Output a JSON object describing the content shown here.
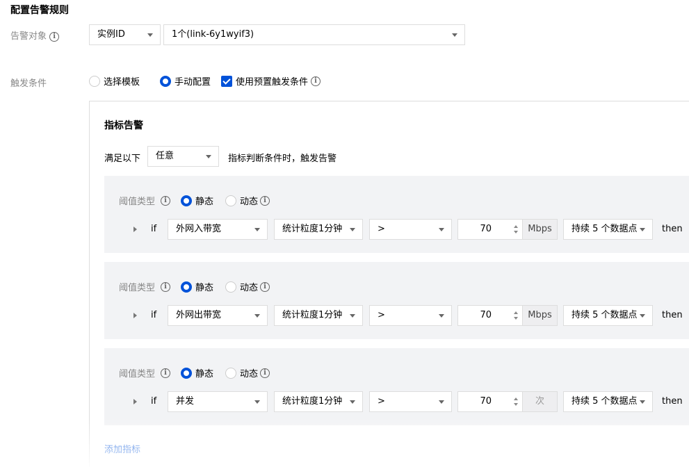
{
  "page_title": "配置告警规则",
  "alarm_target": {
    "label": "告警对象",
    "type_select": "实例ID",
    "instance_select": "1个(link-6y1wyif3)"
  },
  "trigger": {
    "label": "触发条件",
    "option_template": "选择模板",
    "option_manual": "手动配置",
    "checkbox_preset": "使用预置触发条件"
  },
  "metric_alarm": {
    "title": "指标告警",
    "satisfy_prefix": "满足以下",
    "satisfy_select": "任意",
    "satisfy_suffix": "指标判断条件时，触发告警",
    "add_metric": "添加指标",
    "rules": [
      {
        "threshold_label": "阈值类型",
        "static_label": "静态",
        "dynamic_label": "动态",
        "if_label": "if",
        "metric": "外网入带宽",
        "period": "统计粒度1分钟",
        "operator": ">",
        "value": "70",
        "unit": "Mbps",
        "duration": "持续 5 个数据点",
        "then_label": "then"
      },
      {
        "threshold_label": "阈值类型",
        "static_label": "静态",
        "dynamic_label": "动态",
        "if_label": "if",
        "metric": "外网出带宽",
        "period": "统计粒度1分钟",
        "operator": ">",
        "value": "70",
        "unit": "Mbps",
        "duration": "持续 5 个数据点",
        "then_label": "then"
      },
      {
        "threshold_label": "阈值类型",
        "static_label": "静态",
        "dynamic_label": "动态",
        "if_label": "if",
        "metric": "并发",
        "period": "统计粒度1分钟",
        "operator": ">",
        "value": "70",
        "unit": "次",
        "duration": "持续 5 个数据点",
        "then_label": "then"
      }
    ]
  },
  "colors": {
    "accent": "#0052d9",
    "block_bg": "#f2f3f5",
    "label": "#888888"
  },
  "icons": [
    "info-icon",
    "chevron-down-icon",
    "expand-triangle-icon",
    "checkmark-icon",
    "stepper-icon"
  ]
}
